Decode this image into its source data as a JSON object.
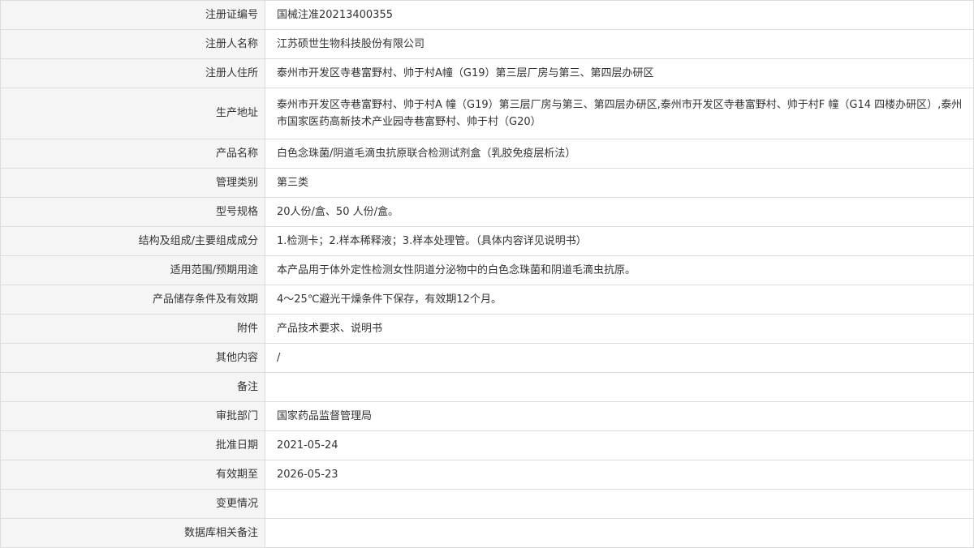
{
  "rows": [
    {
      "label": "注册证编号",
      "value": "国械注准20213400355"
    },
    {
      "label": "注册人名称",
      "value": "江苏硕世生物科技股份有限公司"
    },
    {
      "label": "注册人住所",
      "value": "泰州市开发区寺巷富野村、帅于村A幢（G19）第三层厂房与第三、第四层办研区"
    },
    {
      "label": "生产地址",
      "value": "泰州市开发区寺巷富野村、帅于村A 幢（G19）第三层厂房与第三、第四层办研区,泰州市开发区寺巷富野村、帅于村F 幢（G14 四楼办研区）,泰州市国家医药高新技术产业园寺巷富野村、帅于村（G20）"
    },
    {
      "label": "产品名称",
      "value": "白色念珠菌/阴道毛滴虫抗原联合检测试剂盒（乳胶免疫层析法）"
    },
    {
      "label": "管理类别",
      "value": "第三类"
    },
    {
      "label": "型号规格",
      "value": "20人份/盒、50 人份/盒。"
    },
    {
      "label": "结构及组成/主要组成成分",
      "value": "1.检测卡；2.样本稀释液；3.样本处理管。（具体内容详见说明书）"
    },
    {
      "label": "适用范围/预期用途",
      "value": "本产品用于体外定性检测女性阴道分泌物中的白色念珠菌和阴道毛滴虫抗原。"
    },
    {
      "label": "产品储存条件及有效期",
      "value": "4～25℃避光干燥条件下保存，有效期12个月。"
    },
    {
      "label": "附件",
      "value": "产品技术要求、说明书"
    },
    {
      "label": "其他内容",
      "value": "/"
    },
    {
      "label": "备注",
      "value": ""
    },
    {
      "label": "审批部门",
      "value": "国家药品监督管理局"
    },
    {
      "label": "批准日期",
      "value": "2021-05-24"
    },
    {
      "label": "有效期至",
      "value": "2026-05-23"
    },
    {
      "label": "变更情况",
      "value": ""
    },
    {
      "label": "数据库相关备注",
      "value": ""
    }
  ]
}
